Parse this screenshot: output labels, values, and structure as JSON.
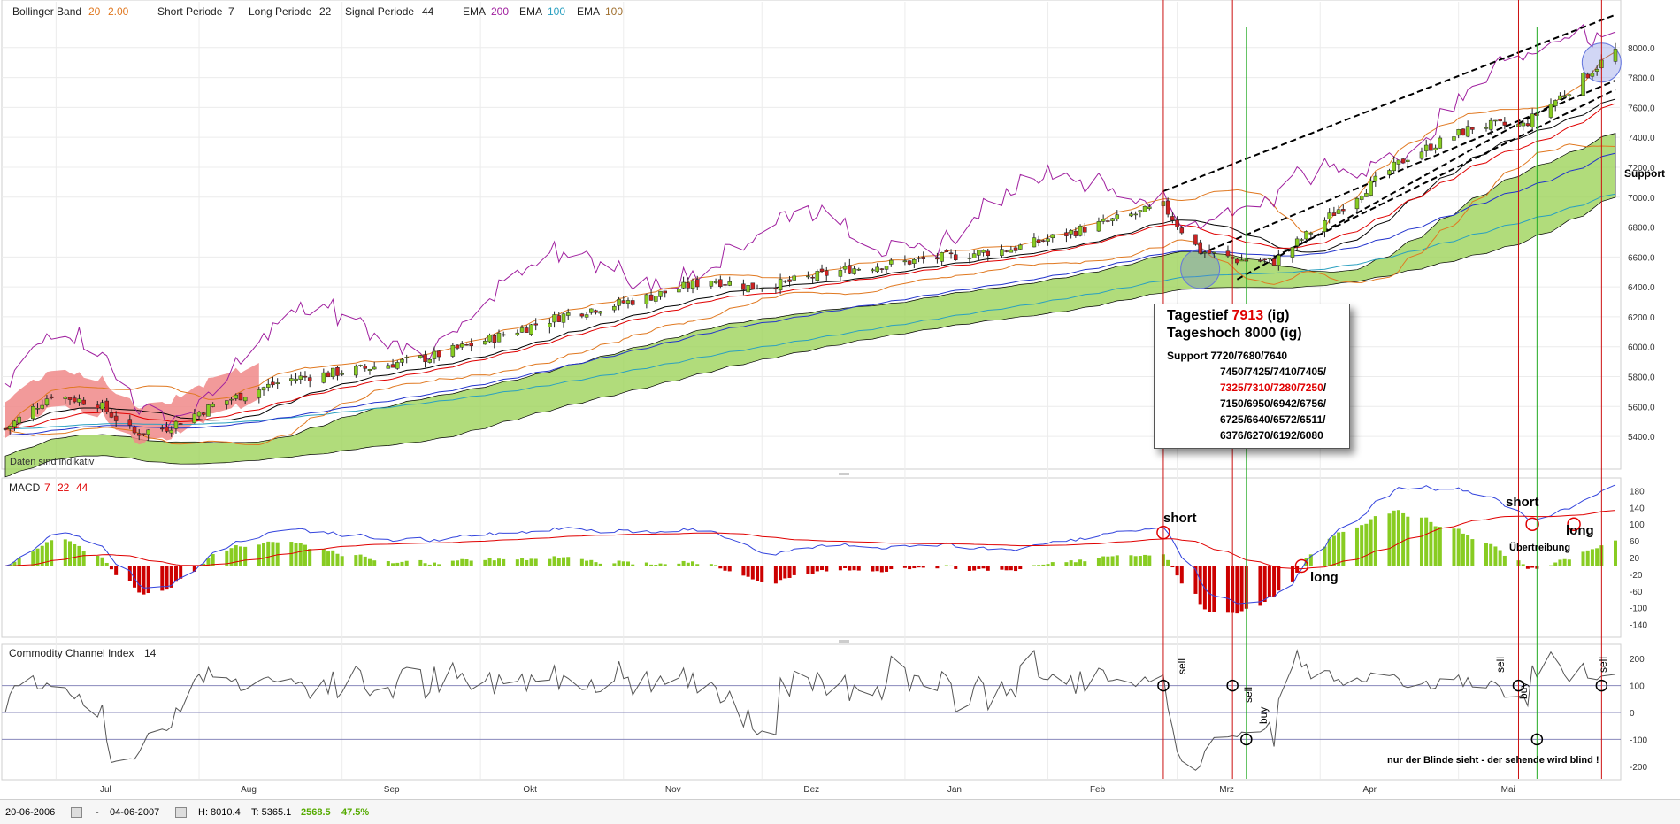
{
  "header": {
    "bollinger_label": "Bollinger Band",
    "bollinger_p1": "20",
    "bollinger_p2": "2.00",
    "short_label": "Short Periode",
    "short_value": "7",
    "long_label": "Long Periode",
    "long_value": "22",
    "signal_label": "Signal Periode",
    "signal_value": "44",
    "ema1_label": "EMA",
    "ema1_value": "200",
    "ema2_label": "EMA",
    "ema2_value": "100",
    "ema3_label": "EMA",
    "ema3_value": "100"
  },
  "colors": {
    "bollinger": "#e07820",
    "ema200": "#a0209f",
    "ema100_a": "#2aa0c0",
    "ema100_b": "#a07030",
    "signal_red": "#e00000",
    "macd_line": "#3344dd",
    "histo_pos": "#88cc22",
    "histo_neg": "#cc0000",
    "cloud_green": "#9dd35a",
    "cloud_red": "#f08888",
    "buy_line": "#22aa22",
    "sell_line": "#cc1111"
  },
  "support_label": "Support",
  "watermark": "Daten sind indikativ",
  "info_box": {
    "line1_prefix": "Tagestief",
    "line1_value": "7913",
    "line1_suffix": "(ig)",
    "line2": "Tageshoch 8000 (ig)",
    "support_title": "Support",
    "support_row1": "7720/7680/7640",
    "support_row2": "7450/7425/7410/7405/",
    "support_row3_red": "7325/7310/7280/7250",
    "support_row3_tail": "/",
    "support_row4": "7150/6950/6942/6756/",
    "support_row5": "6725/6640/6572/6511/",
    "support_row6": "6376/6270/6192/6080"
  },
  "macd_panel": {
    "title": "MACD",
    "p1": "7",
    "p2": "22",
    "p3": "44",
    "annotations": {
      "short1": "short",
      "long1": "long",
      "short2": "short",
      "long2": "long",
      "uebertreibung": "Übertreibung"
    },
    "axis_ticks": [
      "180",
      "140",
      "100",
      "60",
      "20",
      "-20",
      "-60",
      "-100",
      "-140"
    ]
  },
  "cci_panel": {
    "title": "Commodity Channel Index",
    "period": "14",
    "axis_ticks": [
      "200",
      "100",
      "0",
      "-100",
      "-200"
    ],
    "signals": [
      "sell",
      "sell",
      "buy",
      "sell",
      "buy",
      "sell"
    ],
    "quote": "nur der Blinde sieht - der sehende wird blind !"
  },
  "footer": {
    "start_date": "20-06-2006",
    "separator": "-",
    "end_date": "04-06-2007",
    "high": "H: 8010.4",
    "low": "T: 5365.1",
    "change": "2568.5",
    "change_pct": "47.5%"
  },
  "chart_data": {
    "type": "candlestick",
    "title": "",
    "ylim": [
      5300,
      8200
    ],
    "y_ticks": [
      8000.0,
      7800.0,
      7600.0,
      7400.0,
      7200.0,
      7000.0,
      6800.0,
      6600.0,
      6400.0,
      6200.0,
      6000.0,
      5800.0,
      5600.0,
      5400.0
    ],
    "x_month_labels": [
      "Jul",
      "Aug",
      "Sep",
      "Okt",
      "Nov",
      "Dez",
      "Jan",
      "Feb",
      "Mrz",
      "Apr",
      "Mai"
    ],
    "price_anchors": {
      "dates": [
        "2006-06-20",
        "2006-06-30",
        "2006-07-10",
        "2006-07-18",
        "2006-07-25",
        "2006-08-05",
        "2006-08-20",
        "2006-09-05",
        "2006-09-20",
        "2006-10-05",
        "2006-10-20",
        "2006-11-05",
        "2006-11-20",
        "2006-11-28",
        "2006-12-05",
        "2006-12-20",
        "2007-01-10",
        "2007-01-25",
        "2007-02-10",
        "2007-02-26",
        "2007-03-02",
        "2007-03-06",
        "2007-03-14",
        "2007-03-22",
        "2007-04-05",
        "2007-04-20",
        "2007-05-05",
        "2007-05-15",
        "2007-05-25",
        "2007-06-04"
      ],
      "close": [
        5450,
        5680,
        5620,
        5420,
        5460,
        5620,
        5780,
        5850,
        5930,
        6070,
        6220,
        6320,
        6450,
        6400,
        6420,
        6520,
        6600,
        6660,
        6800,
        6940,
        6780,
        6640,
        6580,
        6570,
        6920,
        7270,
        7480,
        7480,
        7720,
        7980
      ]
    },
    "indicators": {
      "bollinger": {
        "period": 20,
        "std": 2.0
      },
      "ema": [
        200,
        100,
        100
      ],
      "ichimoku_cloud": true
    },
    "macd": {
      "short": 7,
      "long": 22,
      "signal": 44,
      "ylim": [
        -160,
        200
      ]
    },
    "cci": {
      "period": 14,
      "levels": [
        100,
        0,
        -100
      ],
      "ylim": [
        -240,
        240
      ]
    },
    "signals": [
      {
        "date": "2007-02-26",
        "type": "sell"
      },
      {
        "date": "2007-03-13",
        "type": "sell"
      },
      {
        "date": "2007-03-16",
        "type": "buy"
      },
      {
        "date": "2007-05-14",
        "type": "sell"
      },
      {
        "date": "2007-05-18",
        "type": "buy"
      },
      {
        "date": "2007-06-01",
        "type": "sell"
      }
    ]
  }
}
